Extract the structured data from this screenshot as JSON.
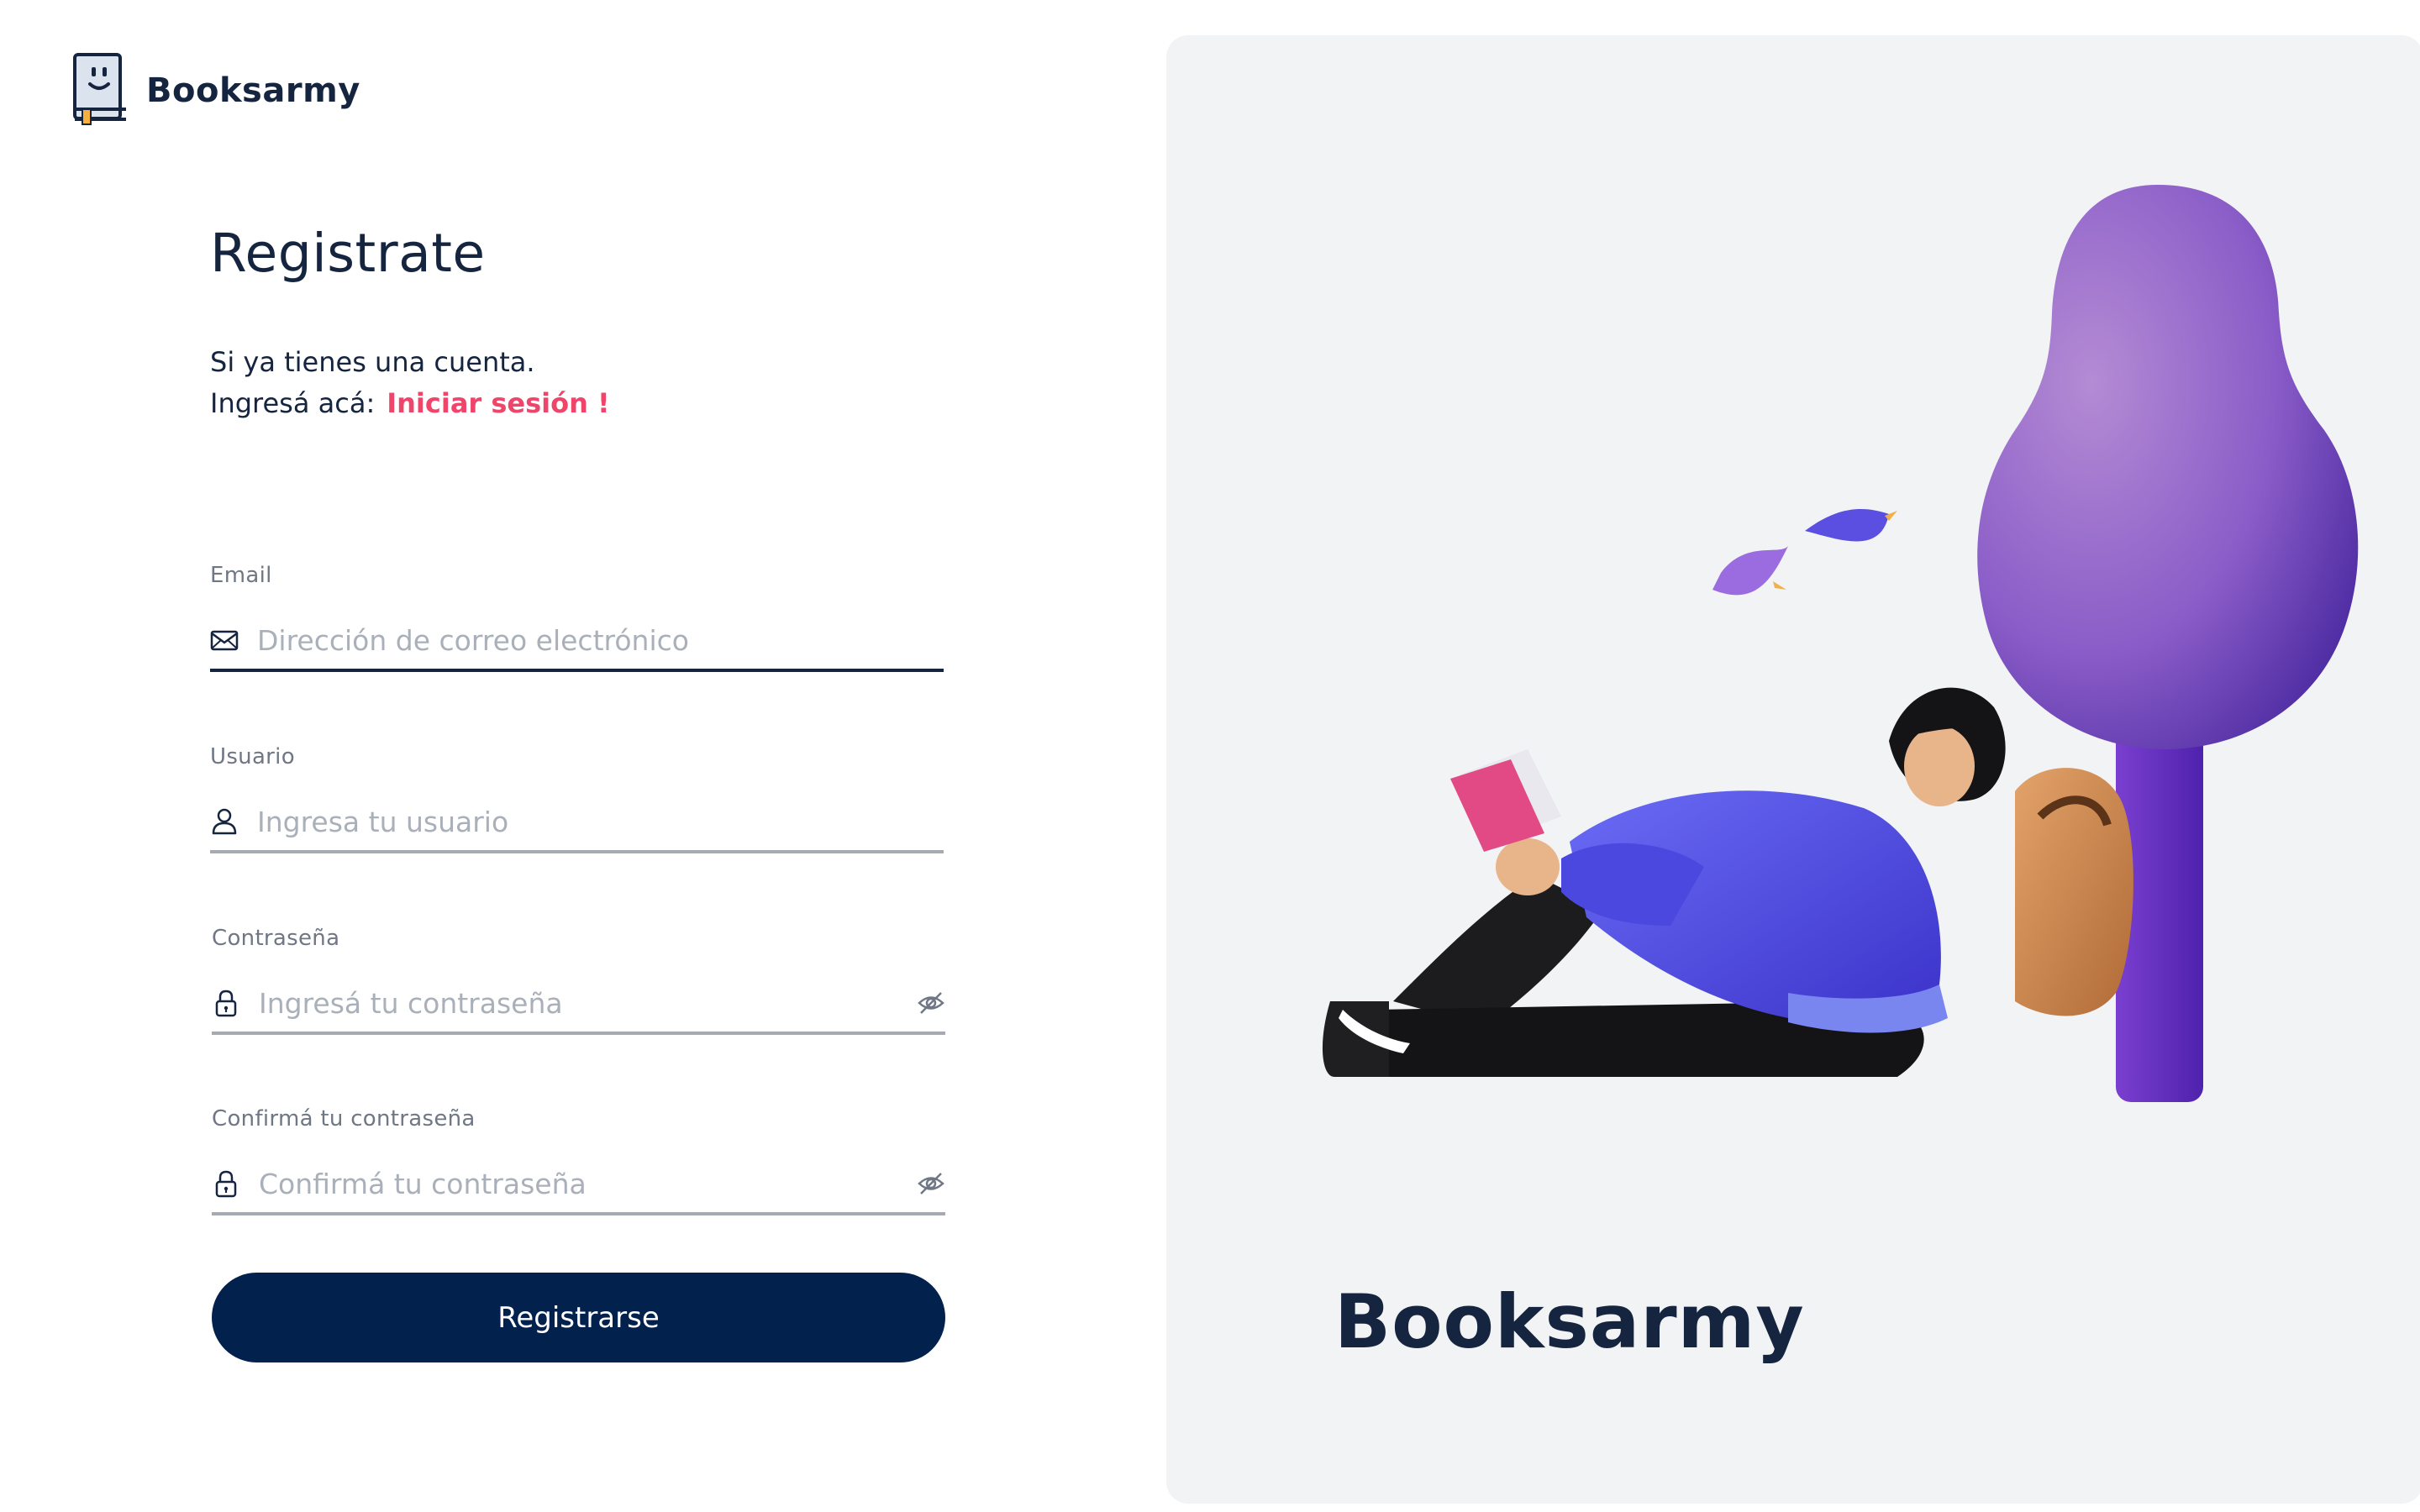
{
  "brand": {
    "name": "Booksarmy",
    "icon": "book-smile-icon"
  },
  "form": {
    "title": "Registrate",
    "subtitle": "Si ya tienes una cuenta.",
    "login_prompt": "Ingresá acá:",
    "login_link": "Iniciar sesión !",
    "fields": [
      {
        "label": "Email",
        "placeholder": "Dirección de correo electrónico",
        "value": "",
        "icon": "mail-icon",
        "active": true
      },
      {
        "label": "Usuario",
        "placeholder": "Ingresa tu usuario",
        "value": "",
        "icon": "user-icon"
      },
      {
        "label": "Contraseña",
        "placeholder": "Ingresá tu contraseña",
        "value": "",
        "icon": "lock-icon",
        "toggle_icon": "eye-off-icon"
      },
      {
        "label": "Confirmá tu contraseña",
        "placeholder": "Confirmá tu contraseña",
        "value": "",
        "icon": "lock-icon",
        "toggle_icon": "eye-off-icon"
      }
    ],
    "submit_label": "Registrarse"
  },
  "side_panel": {
    "brand_text": "Booksarmy",
    "illustration": "person-reading-under-tree-illustration"
  },
  "colors": {
    "primary": "#03214d",
    "accent_link": "#f0456b",
    "text": "#16253f",
    "panel_bg": "#f2f3f5",
    "tree_purple": "#8a5cc8"
  }
}
